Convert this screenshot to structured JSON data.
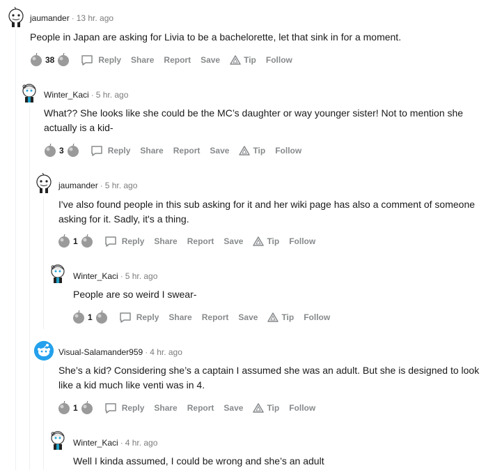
{
  "labels": {
    "reply": "Reply",
    "share": "Share",
    "report": "Report",
    "save": "Save",
    "tip": "Tip",
    "follow": "Follow",
    "separator": "·"
  },
  "comments": [
    {
      "user": "jaumander",
      "time": "13 hr. ago",
      "avatar": "reddit-avatar-jaumander",
      "text": "People in Japan are asking for Livia to be a bachelorette, let that sink in for a moment.",
      "score": "38"
    },
    {
      "user": "Winter_Kaci",
      "time": "5 hr. ago",
      "avatar": "reddit-avatar-winter-kaci",
      "text": "What?? She looks like she could be the MC’s daughter or way younger sister! Not to mention she actually is a kid-",
      "score": "3"
    },
    {
      "user": "jaumander",
      "time": "5 hr. ago",
      "avatar": "reddit-avatar-jaumander",
      "text": "I've also found people in this sub asking for it and her wiki page has also a comment of someone asking for it. Sadly, it's a thing.",
      "score": "1"
    },
    {
      "user": "Winter_Kaci",
      "time": "5 hr. ago",
      "avatar": "reddit-avatar-winter-kaci",
      "text": "People are so weird I swear-",
      "score": "1"
    },
    {
      "user": "Visual-Salamander959",
      "time": "4 hr. ago",
      "avatar": "reddit-avatar-default-blue",
      "text": "She’s a kid? Considering she’s a captain I assumed she was an adult. But she is designed to look like a kid much like venti was in 4.",
      "score": "1"
    },
    {
      "user": "Winter_Kaci",
      "time": "4 hr. ago",
      "avatar": "reddit-avatar-winter-kaci",
      "text": "Well I kinda assumed, I could be wrong and she’s an adult"
    }
  ]
}
